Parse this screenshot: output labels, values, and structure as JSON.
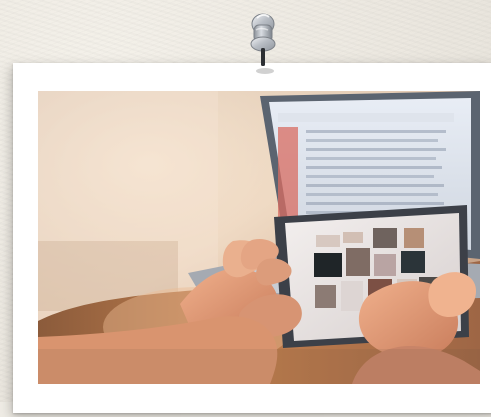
{
  "scene": {
    "type": "pinned-photo-card",
    "background": "#efece5",
    "card_color": "#ffffff"
  },
  "pin": {
    "icon": "pushpin-icon",
    "color": "#b8bcc2"
  },
  "photo": {
    "subject": "hands-using-tablet-near-laptop",
    "palette": [
      "#d8bfa8",
      "#b67b55",
      "#7f8a95",
      "#3b5c89",
      "#e8e3df"
    ]
  }
}
